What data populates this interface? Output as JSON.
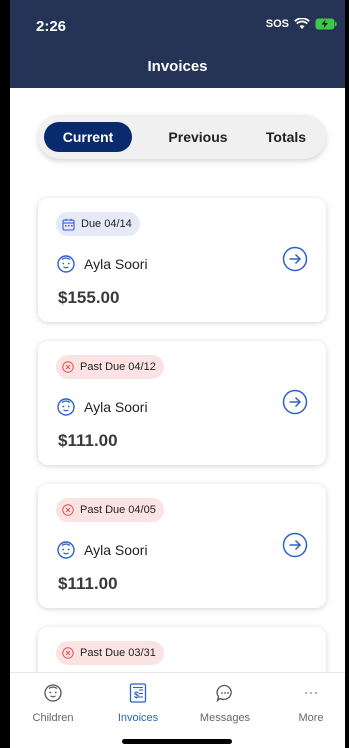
{
  "status_bar": {
    "time": "2:26",
    "sos": "SOS"
  },
  "header": {
    "title": "Invoices"
  },
  "segments": [
    {
      "label": "Current",
      "active": true
    },
    {
      "label": "Previous",
      "active": false
    },
    {
      "label": "Totals",
      "active": false
    }
  ],
  "invoices": [
    {
      "status": "due",
      "badge": "Due 04/14",
      "child": "Ayla Soori",
      "amount": "$155.00"
    },
    {
      "status": "past_due",
      "badge": "Past Due 04/12",
      "child": "Ayla Soori",
      "amount": "$111.00"
    },
    {
      "status": "past_due",
      "badge": "Past Due 04/05",
      "child": "Ayla Soori",
      "amount": "$111.00"
    },
    {
      "status": "past_due",
      "badge": "Past Due 03/31",
      "child": "",
      "amount": ""
    }
  ],
  "tabbar": {
    "items": [
      {
        "label": "Children",
        "icon": "child-face-icon",
        "active": false
      },
      {
        "label": "Invoices",
        "icon": "invoice-icon",
        "active": true
      },
      {
        "label": "Messages",
        "icon": "chat-bubble-icon",
        "active": false
      },
      {
        "label": "More",
        "icon": "more-dots-icon",
        "active": false
      }
    ]
  },
  "colors": {
    "header_bg": "#243356",
    "segment_active": "#0a2a6e",
    "accent_blue": "#2a62c9",
    "due_badge_bg": "#e6e9f8",
    "past_badge_bg": "#fbe3e3",
    "past_icon": "#d9534f"
  }
}
